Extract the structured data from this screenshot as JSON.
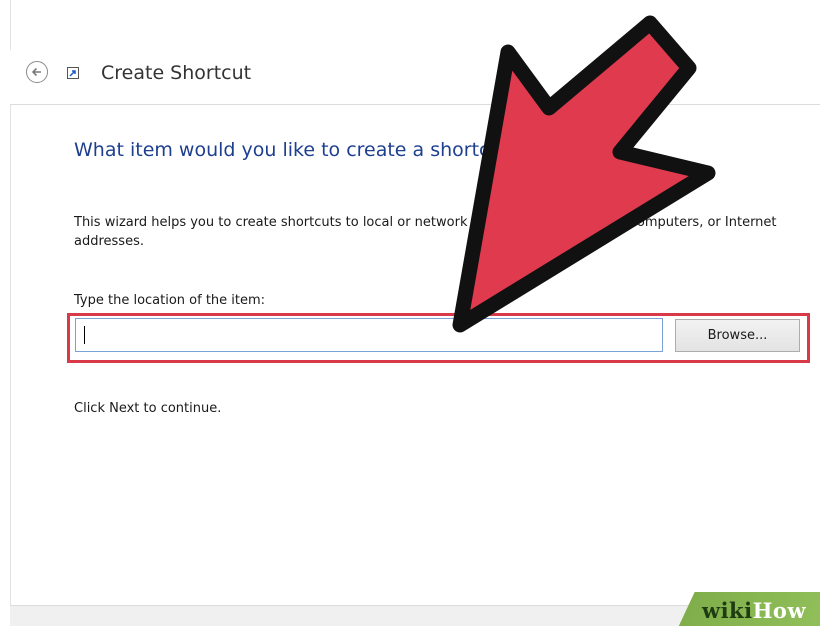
{
  "window": {
    "title": "Create Shortcut"
  },
  "wizard": {
    "heading": "What item would you like to create a shortcut for?",
    "description": "This wizard helps you to create shortcuts to local or network programs, files, folders, computers, or Internet addresses.",
    "location_label": "Type the location of the item:",
    "location_value": "",
    "browse_label": "Browse...",
    "continue_text": "Click Next to continue."
  },
  "watermark": {
    "wiki": "wiki",
    "how": "How"
  },
  "icons": {
    "back": "back-arrow-icon",
    "shortcut": "shortcut-icon",
    "annotation": "red-arrow-icon"
  },
  "colors": {
    "heading_blue": "#1e3f8f",
    "highlight_red": "#d93a4a",
    "arrow_red": "#e03a4e",
    "watermark_green": "#86b550"
  }
}
